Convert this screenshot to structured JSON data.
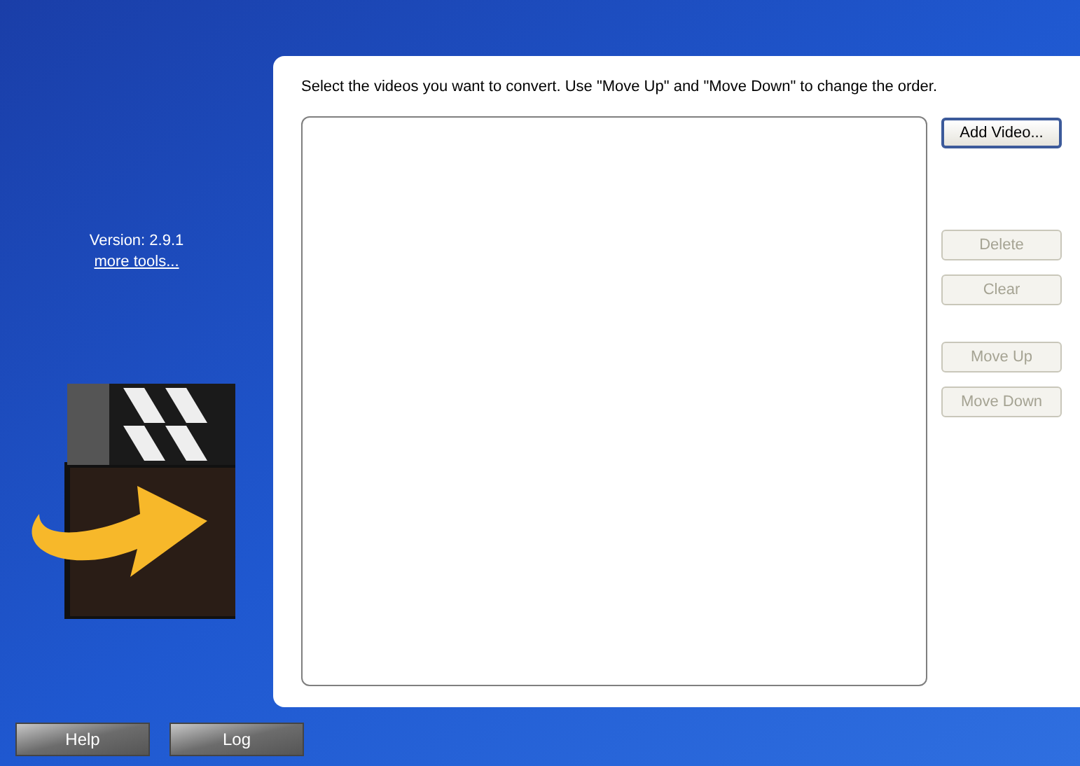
{
  "sidebar": {
    "version": "Version: 2.9.1",
    "link": "more tools..."
  },
  "instruction": "Select the videos you want to convert. Use \"Move Up\" and \"Move Down\" to change the order.",
  "side_buttons": [
    {
      "label": "Add Video...",
      "disabled": false
    },
    {
      "label": "Delete",
      "disabled": true
    },
    {
      "label": "Clear",
      "disabled": true
    },
    {
      "label": "Move Up",
      "disabled": true
    },
    {
      "label": "Move Down",
      "disabled": true
    }
  ],
  "bottom_buttons": [
    "Help",
    "Log"
  ]
}
